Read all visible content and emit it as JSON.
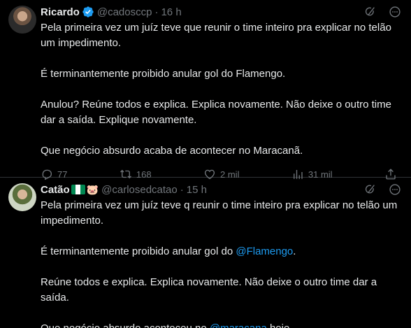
{
  "tweets": [
    {
      "name": "Ricardo",
      "handle": "@cadosccp",
      "time": "16 h",
      "paragraphs": [
        "Pela primeira vez um juíz teve que reunir o time inteiro pra explicar no telão um impedimento.",
        "É terminantemente proibido anular gol do Flamengo.",
        "Anulou? Reúne todos e explica. Explica novamente. Não deixe o outro time dar a saída. Explique novamente.",
        "Que negócio absurdo acaba de acontecer no Maracanã."
      ],
      "replies": "77",
      "retweets": "168",
      "likes": "2 mil",
      "views": "31 mil"
    },
    {
      "name": "Catão",
      "handle": "@carlosedcatao",
      "time": "15 h",
      "p1": "Pela primeira vez um juíz teve q reunir o time inteiro pra explicar no telão um impedimento.",
      "p2_pre": "É terminantemente proibido anular gol do ",
      "p2_mention": "@Flamengo",
      "p2_post": ".",
      "p3": "Reúne todos e explica. Explica novamente. Não deixe o outro time dar a saída.",
      "p4_pre": "Que negócio absurdo aconteceu no ",
      "p4_mention": "@maracana",
      "p4_post": " hoje.",
      "pig": "🐷"
    }
  ],
  "icons": {
    "grok": "grok-icon",
    "more": "more-icon",
    "reply": "reply-icon",
    "retweet": "retweet-icon",
    "like": "like-icon",
    "views": "views-icon",
    "share": "share-icon",
    "verified": "verified-badge-icon"
  },
  "colors": {
    "background": "#000000",
    "text": "#e7e9ea",
    "secondary": "#71767b",
    "accent": "#1d9bf0",
    "divider": "#2f3336"
  }
}
